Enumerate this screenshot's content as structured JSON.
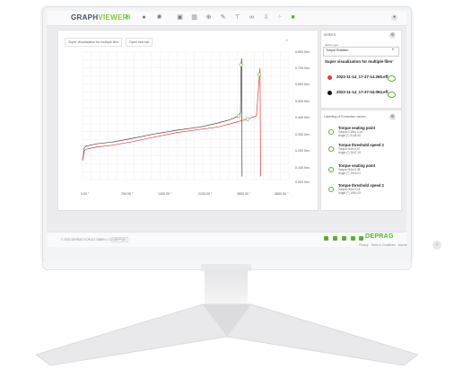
{
  "app": {
    "logo_part1": "GRAPH",
    "logo_part2": "VIEWER"
  },
  "toolbar": {
    "icons": [
      "add-chart-icon",
      "cursor-icon",
      "settings-icon",
      "layers-icon",
      "bar-chart-icon",
      "zoom-icon",
      "magic-wand-icon",
      "filter-icon",
      "link-icon",
      "download-icon",
      "grid-icon",
      "export-icon"
    ],
    "right_icon": "user-icon"
  },
  "chart": {
    "chips": [
      "Super visualization for multiple files",
      "Open new tab"
    ],
    "close_label": "×",
    "y_ticks": [
      "0.800 Nm",
      "0.700 Nm",
      "0.600 Nm",
      "0.500 Nm",
      "0.400 Nm",
      "0.300 Nm",
      "0.200 Nm",
      "0.100 Nm",
      "0.000 Nm"
    ],
    "x_ticks": [
      "0.00 °",
      "700.00 °",
      "1400.00 °",
      "2100.00 °",
      "2800.00 °",
      "3500.00 °"
    ]
  },
  "chart_data": {
    "type": "line",
    "xlabel": "",
    "ylabel": "",
    "xlim": [
      0,
      3500
    ],
    "ylim": [
      0,
      0.8
    ],
    "grid": true,
    "series": [
      {
        "color": "#444444",
        "x": [
          0,
          30,
          60,
          120,
          250,
          500,
          800,
          1200,
          1600,
          2000,
          2300,
          2500,
          2650,
          2680,
          2690,
          2700,
          2705
        ],
        "y": [
          0.12,
          0.2,
          0.21,
          0.215,
          0.225,
          0.235,
          0.255,
          0.285,
          0.31,
          0.33,
          0.355,
          0.375,
          0.4,
          0.42,
          0.72,
          0.76,
          0.02
        ]
      },
      {
        "color": "#e53935",
        "x": [
          0,
          30,
          60,
          120,
          250,
          500,
          800,
          1200,
          1600,
          2000,
          2300,
          2600,
          2800,
          2950,
          3000,
          3010,
          3020
        ],
        "y": [
          0.12,
          0.18,
          0.19,
          0.195,
          0.205,
          0.215,
          0.235,
          0.265,
          0.295,
          0.315,
          0.33,
          0.36,
          0.38,
          0.4,
          0.66,
          0.7,
          0.02
        ]
      }
    ]
  },
  "sidebar": {
    "panel1_title": "SERIES",
    "select_label": "Series type",
    "select_value": "Torque Rotation",
    "section_title": "Super visualization for multiple files",
    "files": [
      {
        "name": "2022-11-14_17-37-14.268.eff",
        "color": "#e53935"
      },
      {
        "name": "2022-11-14_17-37-04.094.eff",
        "color": "#111111"
      }
    ],
    "panel2_title": "Labelling of Extraction values",
    "items": [
      {
        "title": "Torque seating point",
        "line1": "Torque 0,1Nm 3,1n",
        "line2": "Angle (°) 3144,40"
      },
      {
        "title": "Torque threshold speed 2",
        "line1": "Torque 0Nm 0,57",
        "line2": "Angle (°) 2047,19"
      },
      {
        "title": "Torque seating point",
        "line1": "Torque 0Nm 0,38",
        "line2": "Angle (°) 1915,01"
      },
      {
        "title": "Torque threshold speed 2",
        "line1": "Torque 0Nm 0,18",
        "line2": "Angle (°) 1991,03"
      }
    ]
  },
  "footer": {
    "copyright": "© 2022 DEPRAG SCHULZ GMBH u. CO.",
    "badge": "DEPRAG",
    "brand": "DEPRAG",
    "links": "Privacy · Terms & Conditions · Imprint"
  }
}
